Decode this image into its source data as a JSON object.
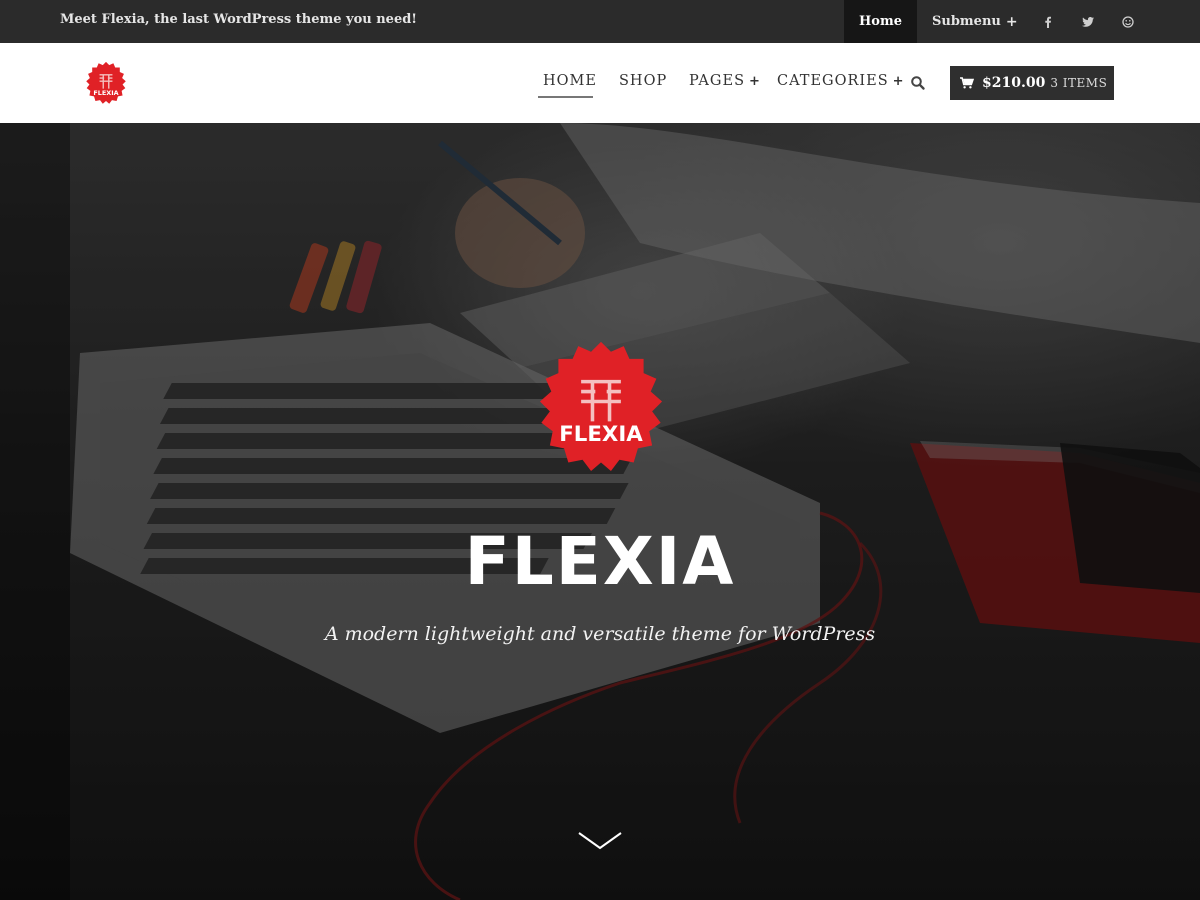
{
  "topbar": {
    "message": "Meet Flexia, the last WordPress theme you need!",
    "menu": {
      "home_label": "Home",
      "submenu_label": "Submenu",
      "plus_glyph": "+"
    },
    "social_icons": [
      "facebook-icon",
      "twitter-icon",
      "smiley-icon"
    ]
  },
  "header": {
    "logo_text": "FLEXIA",
    "nav": {
      "home": "HOME",
      "shop": "SHOP",
      "pages": "PAGES",
      "categories": "CATEGORIES",
      "plus_glyph": "+"
    },
    "cart": {
      "total": "$210.00",
      "count": "3 ITEMS"
    }
  },
  "hero": {
    "logo_text": "FLEXIA",
    "title": "FLEXIA",
    "tagline": "A modern lightweight and versatile theme for WordPress"
  },
  "colors": {
    "accent": "#e02126",
    "topbar_bg": "#2b2b2b",
    "cart_bg": "#2f2f2f"
  }
}
